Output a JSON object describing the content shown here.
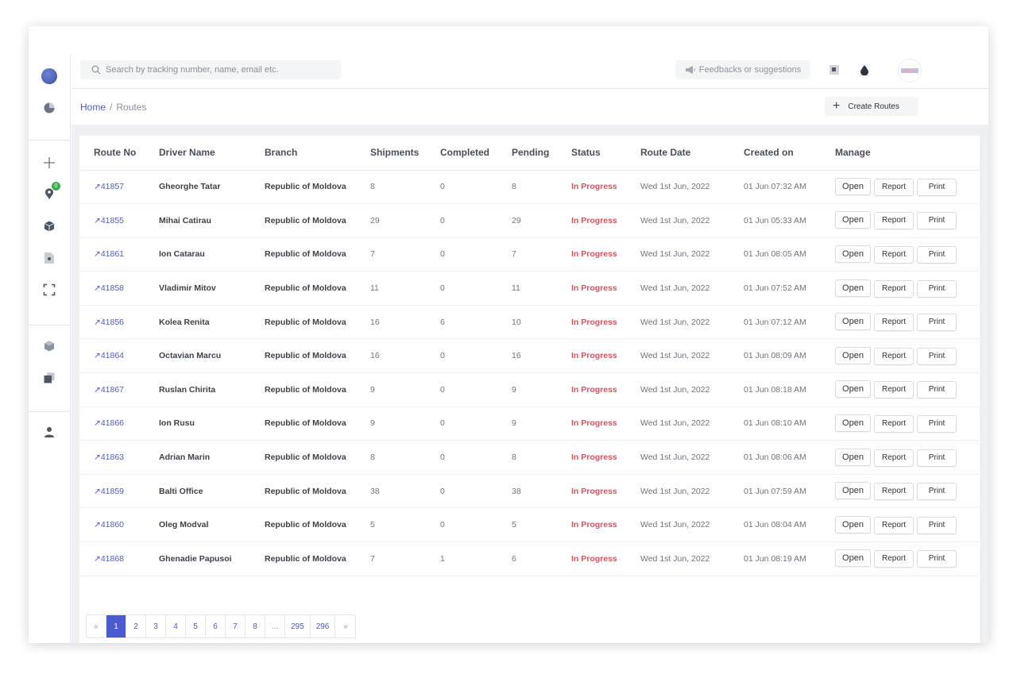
{
  "search": {
    "placeholder": "Search by tracking number, name, email etc."
  },
  "header": {
    "feedback_label": "Feedbacks or suggestions"
  },
  "sidebar": {
    "badge_count": "0"
  },
  "breadcrumb": {
    "home": "Home",
    "separator": "/",
    "current": "Routes"
  },
  "actions": {
    "create_label": "Create Routes"
  },
  "table": {
    "headers": [
      "Route No",
      "Driver Name",
      "Branch",
      "Shipments",
      "Completed",
      "Pending",
      "Status",
      "Route Date",
      "Created on",
      "Manage"
    ],
    "rows": [
      {
        "route": "41857",
        "driver": "Gheorghe Tatar",
        "branch": "Republic of Moldova",
        "shipments": "8",
        "completed": "0",
        "pending": "8",
        "status": "In Progress",
        "date": "Wed 1st Jun, 2022",
        "created": "01 Jun 07:32 AM"
      },
      {
        "route": "41855",
        "driver": "Mihai Catirau",
        "branch": "Republic of Moldova",
        "shipments": "29",
        "completed": "0",
        "pending": "29",
        "status": "In Progress",
        "date": "Wed 1st Jun, 2022",
        "created": "01 Jun 05:33 AM"
      },
      {
        "route": "41861",
        "driver": "Ion Catarau",
        "branch": "Republic of Moldova",
        "shipments": "7",
        "completed": "0",
        "pending": "7",
        "status": "In Progress",
        "date": "Wed 1st Jun, 2022",
        "created": "01 Jun 08:05 AM"
      },
      {
        "route": "41858",
        "driver": "Vladimir Mitov",
        "branch": "Republic of Moldova",
        "shipments": "11",
        "completed": "0",
        "pending": "11",
        "status": "In Progress",
        "date": "Wed 1st Jun, 2022",
        "created": "01 Jun 07:52 AM"
      },
      {
        "route": "41856",
        "driver": "Kolea Renita",
        "branch": "Republic of Moldova",
        "shipments": "16",
        "completed": "6",
        "pending": "10",
        "status": "In Progress",
        "date": "Wed 1st Jun, 2022",
        "created": "01 Jun 07:12 AM"
      },
      {
        "route": "41864",
        "driver": "Octavian Marcu",
        "branch": "Republic of Moldova",
        "shipments": "16",
        "completed": "0",
        "pending": "16",
        "status": "In Progress",
        "date": "Wed 1st Jun, 2022",
        "created": "01 Jun 08:09 AM"
      },
      {
        "route": "41867",
        "driver": "Ruslan Chirita",
        "branch": "Republic of Moldova",
        "shipments": "9",
        "completed": "0",
        "pending": "9",
        "status": "In Progress",
        "date": "Wed 1st Jun, 2022",
        "created": "01 Jun 08:18 AM"
      },
      {
        "route": "41866",
        "driver": "Ion Rusu",
        "branch": "Republic of Moldova",
        "shipments": "9",
        "completed": "0",
        "pending": "9",
        "status": "In Progress",
        "date": "Wed 1st Jun, 2022",
        "created": "01 Jun 08:10 AM"
      },
      {
        "route": "41863",
        "driver": "Adrian Marin",
        "branch": "Republic of Moldova",
        "shipments": "8",
        "completed": "0",
        "pending": "8",
        "status": "In Progress",
        "date": "Wed 1st Jun, 2022",
        "created": "01 Jun 08:06 AM"
      },
      {
        "route": "41859",
        "driver": "Balti Office",
        "branch": "Republic of Moldova",
        "shipments": "38",
        "completed": "0",
        "pending": "38",
        "status": "In Progress",
        "date": "Wed 1st Jun, 2022",
        "created": "01 Jun 07:59 AM"
      },
      {
        "route": "41860",
        "driver": "Oleg Modval",
        "branch": "Republic of Moldova",
        "shipments": "5",
        "completed": "0",
        "pending": "5",
        "status": "In Progress",
        "date": "Wed 1st Jun, 2022",
        "created": "01 Jun 08:04 AM"
      },
      {
        "route": "41868",
        "driver": "Ghenadie Papusoi",
        "branch": "Republic of Moldova",
        "shipments": "7",
        "completed": "1",
        "pending": "6",
        "status": "In Progress",
        "date": "Wed 1st Jun, 2022",
        "created": "01 Jun 08:19 AM"
      }
    ],
    "row_actions": {
      "open": "Open",
      "report": "Report",
      "print": "Print"
    }
  },
  "pagination": {
    "prev": "«",
    "pages": [
      "1",
      "2",
      "3",
      "4",
      "5",
      "6",
      "7",
      "8",
      "...",
      "295",
      "296"
    ],
    "next": "»",
    "current": "1"
  },
  "colors": {
    "accent": "#4a5bd1",
    "status_in_progress": "#e0505d",
    "badge": "#38b24a"
  },
  "icons": [
    "logo-icon",
    "pie-chart-icon",
    "plus-icon",
    "location-pin-icon",
    "box-icon",
    "document-icon",
    "scan-icon",
    "cube-icon",
    "copy-icon",
    "user-icon",
    "megaphone-icon",
    "window-icon",
    "drop-icon",
    "arrow-up-right-icon"
  ]
}
